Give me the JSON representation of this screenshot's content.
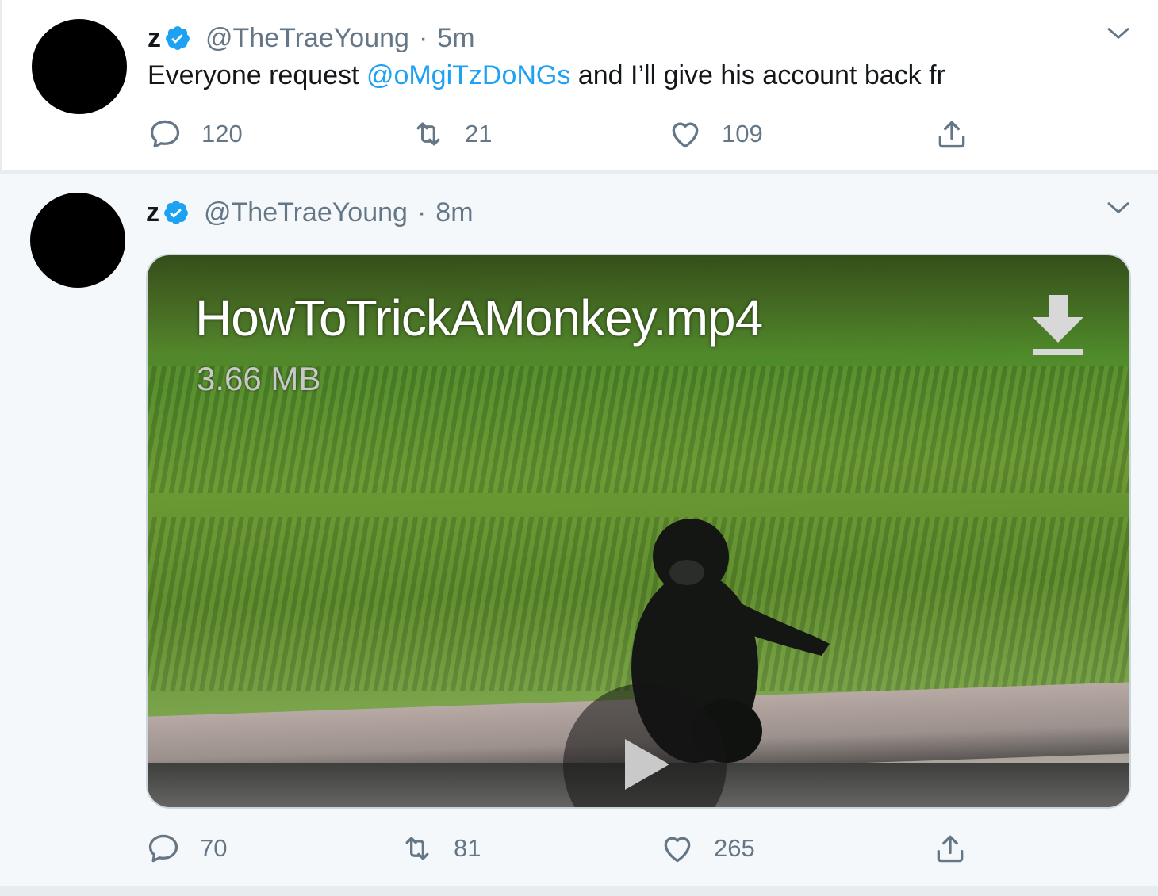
{
  "tweets": [
    {
      "display_name": "z",
      "handle": "@TheTraeYoung",
      "separator": "·",
      "time": "5m",
      "text_before": "Everyone request ",
      "mention": "@oMgiTzDoNGs",
      "text_after": " and I’ll give his account back fr",
      "reply_count": "120",
      "retweet_count": "21",
      "like_count": "109"
    },
    {
      "display_name": "z",
      "handle": "@TheTraeYoung",
      "separator": "·",
      "time": "8m",
      "media": {
        "file_name": "HowToTrickAMonkey.mp4",
        "file_size": "3.66 MB"
      },
      "reply_count": "70",
      "retweet_count": "81",
      "like_count": "265"
    }
  ],
  "colors": {
    "accent": "#1da1f2",
    "muted": "#657786",
    "text": "#14171a"
  },
  "icons": {
    "verified": "verified-badge-icon",
    "caret": "chevron-down-icon",
    "reply": "reply-bubble-icon",
    "retweet": "retweet-icon",
    "like": "heart-icon",
    "share": "share-upload-icon",
    "download": "download-arrow-icon",
    "play": "play-icon"
  }
}
